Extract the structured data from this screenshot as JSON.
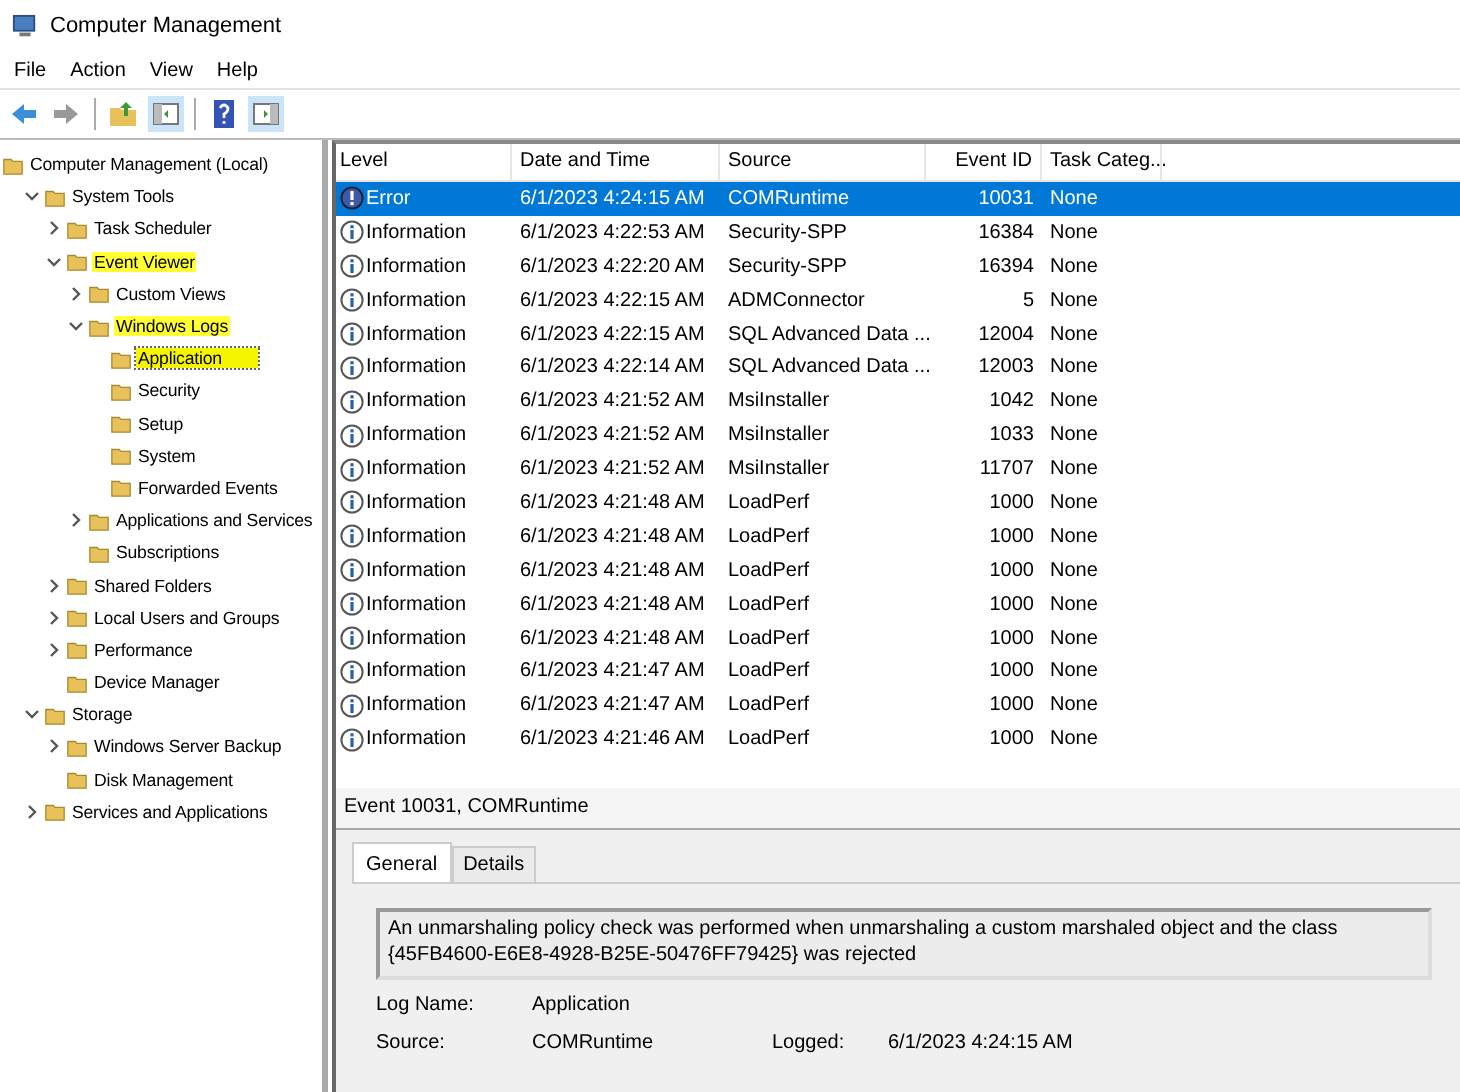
{
  "window": {
    "title": "Computer Management"
  },
  "menu": [
    "File",
    "Action",
    "View",
    "Help"
  ],
  "tree": [
    {
      "label": "Computer Management (Local)",
      "highlighted": false,
      "selected": false,
      "children": [
        {
          "label": "System Tools",
          "expanded": true,
          "highlighted": false,
          "selected": false,
          "children": [
            {
              "label": "Task Scheduler",
              "expanded": false,
              "highlighted": false,
              "selected": false
            },
            {
              "label": "Event Viewer",
              "expanded": true,
              "highlighted": true,
              "selected": false,
              "children": [
                {
                  "label": "Custom Views",
                  "expanded": false,
                  "highlighted": false,
                  "selected": false
                },
                {
                  "label": "Windows Logs",
                  "expanded": true,
                  "highlighted": true,
                  "selected": false,
                  "children": [
                    {
                      "label": "Application",
                      "highlighted": true,
                      "selected": true
                    },
                    {
                      "label": "Security",
                      "highlighted": false,
                      "selected": false
                    },
                    {
                      "label": "Setup",
                      "highlighted": false,
                      "selected": false
                    },
                    {
                      "label": "System",
                      "highlighted": false,
                      "selected": false
                    },
                    {
                      "label": "Forwarded Events",
                      "highlighted": false,
                      "selected": false
                    }
                  ]
                },
                {
                  "label": "Applications and Services",
                  "expanded": false,
                  "highlighted": false,
                  "selected": false
                },
                {
                  "label": "Subscriptions",
                  "highlighted": false,
                  "selected": false
                }
              ]
            },
            {
              "label": "Shared Folders",
              "expanded": false,
              "highlighted": false,
              "selected": false
            },
            {
              "label": "Local Users and Groups",
              "expanded": false,
              "highlighted": false,
              "selected": false
            },
            {
              "label": "Performance",
              "expanded": false,
              "highlighted": false,
              "selected": false
            },
            {
              "label": "Device Manager",
              "highlighted": false,
              "selected": false
            }
          ]
        },
        {
          "label": "Storage",
          "expanded": true,
          "highlighted": false,
          "selected": false,
          "children": [
            {
              "label": "Windows Server Backup",
              "expanded": false,
              "highlighted": false,
              "selected": false
            },
            {
              "label": "Disk Management",
              "highlighted": false,
              "selected": false
            }
          ]
        },
        {
          "label": "Services and Applications",
          "expanded": false,
          "highlighted": false,
          "selected": false
        }
      ]
    }
  ],
  "table": {
    "columns": [
      "Level",
      "Date and Time",
      "Source",
      "Event ID",
      "Task Categ..."
    ],
    "rows": [
      {
        "kind": "error",
        "level": "Error",
        "date": "6/1/2023 4:24:15 AM",
        "source": "COMRuntime",
        "event_id": "10031",
        "category": "None",
        "selected": true
      },
      {
        "kind": "information",
        "level": "Information",
        "date": "6/1/2023 4:22:53 AM",
        "source": "Security-SPP",
        "event_id": "16384",
        "category": "None",
        "selected": false
      },
      {
        "kind": "information",
        "level": "Information",
        "date": "6/1/2023 4:22:20 AM",
        "source": "Security-SPP",
        "event_id": "16394",
        "category": "None",
        "selected": false
      },
      {
        "kind": "information",
        "level": "Information",
        "date": "6/1/2023 4:22:15 AM",
        "source": "ADMConnector",
        "event_id": "5",
        "category": "None",
        "selected": false
      },
      {
        "kind": "information",
        "level": "Information",
        "date": "6/1/2023 4:22:15 AM",
        "source": "SQL Advanced Data ...",
        "event_id": "12004",
        "category": "None",
        "selected": false
      },
      {
        "kind": "information",
        "level": "Information",
        "date": "6/1/2023 4:22:14 AM",
        "source": "SQL Advanced Data ...",
        "event_id": "12003",
        "category": "None",
        "selected": false
      },
      {
        "kind": "information",
        "level": "Information",
        "date": "6/1/2023 4:21:52 AM",
        "source": "MsiInstaller",
        "event_id": "1042",
        "category": "None",
        "selected": false
      },
      {
        "kind": "information",
        "level": "Information",
        "date": "6/1/2023 4:21:52 AM",
        "source": "MsiInstaller",
        "event_id": "1033",
        "category": "None",
        "selected": false
      },
      {
        "kind": "information",
        "level": "Information",
        "date": "6/1/2023 4:21:52 AM",
        "source": "MsiInstaller",
        "event_id": "11707",
        "category": "None",
        "selected": false
      },
      {
        "kind": "information",
        "level": "Information",
        "date": "6/1/2023 4:21:48 AM",
        "source": "LoadPerf",
        "event_id": "1000",
        "category": "None",
        "selected": false
      },
      {
        "kind": "information",
        "level": "Information",
        "date": "6/1/2023 4:21:48 AM",
        "source": "LoadPerf",
        "event_id": "1000",
        "category": "None",
        "selected": false
      },
      {
        "kind": "information",
        "level": "Information",
        "date": "6/1/2023 4:21:48 AM",
        "source": "LoadPerf",
        "event_id": "1000",
        "category": "None",
        "selected": false
      },
      {
        "kind": "information",
        "level": "Information",
        "date": "6/1/2023 4:21:48 AM",
        "source": "LoadPerf",
        "event_id": "1000",
        "category": "None",
        "selected": false
      },
      {
        "kind": "information",
        "level": "Information",
        "date": "6/1/2023 4:21:48 AM",
        "source": "LoadPerf",
        "event_id": "1000",
        "category": "None",
        "selected": false
      },
      {
        "kind": "information",
        "level": "Information",
        "date": "6/1/2023 4:21:47 AM",
        "source": "LoadPerf",
        "event_id": "1000",
        "category": "None",
        "selected": false
      },
      {
        "kind": "information",
        "level": "Information",
        "date": "6/1/2023 4:21:47 AM",
        "source": "LoadPerf",
        "event_id": "1000",
        "category": "None",
        "selected": false
      },
      {
        "kind": "information",
        "level": "Information",
        "date": "6/1/2023 4:21:46 AM",
        "source": "LoadPerf",
        "event_id": "1000",
        "category": "None",
        "selected": false
      }
    ]
  },
  "details": {
    "title": "Event 10031, COMRuntime",
    "tabs": [
      {
        "label": "General",
        "selected": true
      },
      {
        "label": "Details",
        "selected": false
      }
    ],
    "message": "An unmarshaling policy check was performed when unmarshaling a custom marshaled object and the class {45FB4600-E6E8-4928-B25E-50476FF79425} was rejected",
    "fields": [
      {
        "label": "Log Name:",
        "value": "Application"
      },
      {
        "label": "Source:",
        "value": "COMRuntime",
        "label_2": "Logged:",
        "value_2": "6/1/2023 4:24:15 AM"
      }
    ]
  }
}
